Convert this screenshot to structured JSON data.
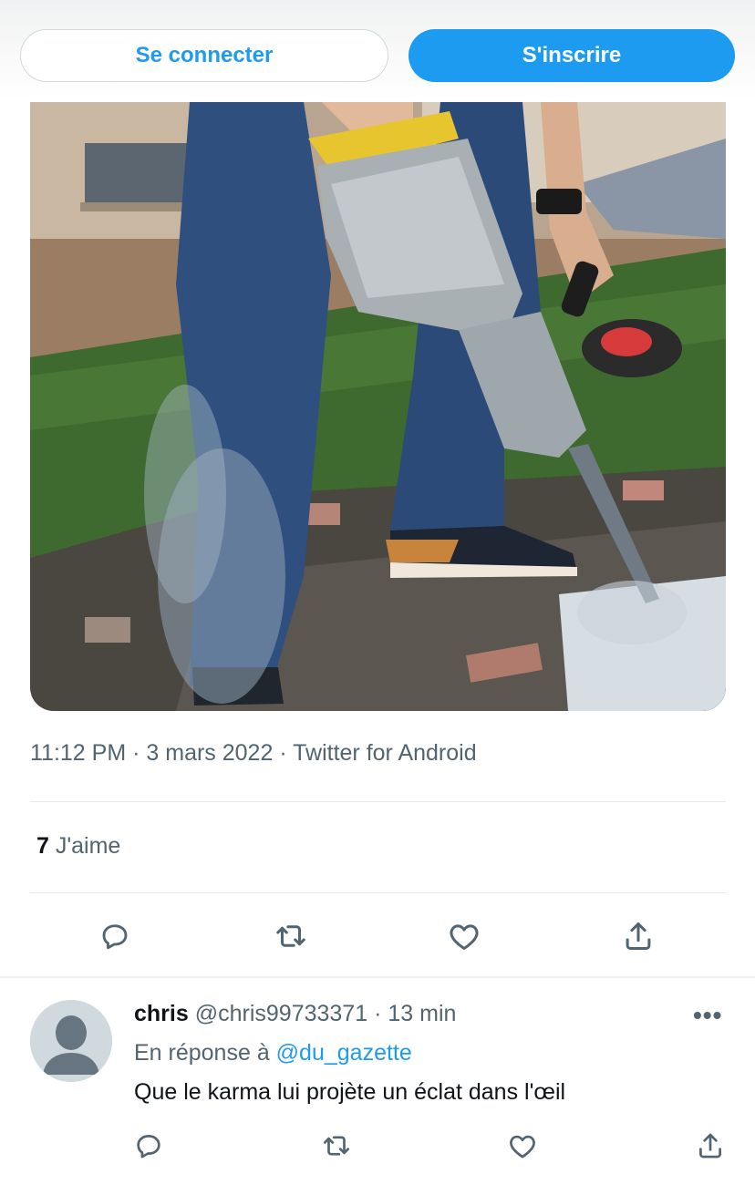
{
  "header": {
    "login_label": "Se connecter",
    "signup_label": "S'inscrire"
  },
  "tweet": {
    "time": "11:12 PM",
    "date": "3 mars 2022",
    "source": "Twitter for Android",
    "separator": "·",
    "likes_count": "7",
    "likes_label": "J'aime",
    "actions": [
      "reply-icon",
      "retweet-icon",
      "like-icon",
      "share-icon"
    ]
  },
  "reply": {
    "name": "chris",
    "handle": "@chris99733371",
    "age": "13 min",
    "more": "•••",
    "replying_prefix": "En réponse à",
    "replying_to": "@du_gazette",
    "text": "Que le karma lui projète un éclat dans l'œil",
    "actions": [
      "reply-icon",
      "retweet-icon",
      "like-icon",
      "share-icon"
    ]
  },
  "colors": {
    "accent": "#1d9bf0",
    "secondary_text": "#536471",
    "divider": "#e7e9ea"
  }
}
